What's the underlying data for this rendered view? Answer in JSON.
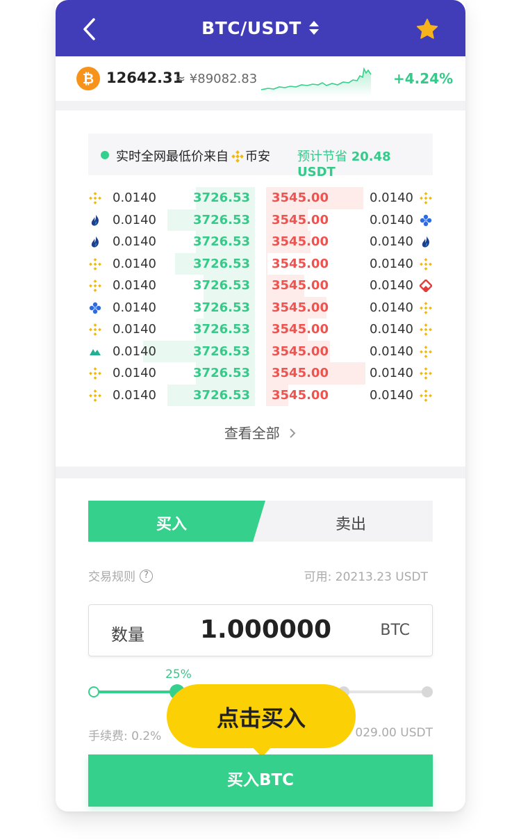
{
  "header": {
    "pair": "BTC/USDT"
  },
  "ticker": {
    "coin_symbol": "₿",
    "price": "12642.31",
    "cny": "≈ ¥89082.83",
    "change": "+4.24%"
  },
  "banner": {
    "text": "实时全网最低价来自",
    "exchange": "币安",
    "save_label": "预计节省",
    "save_value": "20.48 USDT"
  },
  "orderbook": {
    "rows": [
      {
        "left_icon": "binance-icon",
        "bid_amount": "0.0140",
        "bid_price": "3726.53",
        "bid_depth": 0.37,
        "ask_price": "3545.00",
        "ask_depth": 0.61,
        "ask_amount": "0.0140",
        "right_icon": "binance-icon"
      },
      {
        "left_icon": "huobi-icon",
        "bid_amount": "0.0140",
        "bid_price": "3726.53",
        "bid_depth": 0.55,
        "ask_price": "3545.00",
        "ask_depth": 0.26,
        "ask_amount": "0.0140",
        "right_icon": "okex-icon"
      },
      {
        "left_icon": "huobi-icon",
        "bid_amount": "0.0140",
        "bid_price": "3726.53",
        "bid_depth": 0.37,
        "ask_price": "3545.00",
        "ask_depth": 0.28,
        "ask_amount": "0.0140",
        "right_icon": "huobi-icon"
      },
      {
        "left_icon": "binance-icon",
        "bid_amount": "0.0140",
        "bid_price": "3726.53",
        "bid_depth": 0.5,
        "ask_price": "3545.00",
        "ask_depth": 0.01,
        "ask_amount": "0.0140",
        "right_icon": "binance-icon"
      },
      {
        "left_icon": "binance-icon",
        "bid_amount": "0.0140",
        "bid_price": "3726.53",
        "bid_depth": 0.32,
        "ask_price": "3545.00",
        "ask_depth": 0.24,
        "ask_amount": "0.0140",
        "right_icon": "gate-icon"
      },
      {
        "left_icon": "okex-icon",
        "bid_amount": "0.0140",
        "bid_price": "3726.53",
        "bid_depth": 0.32,
        "ask_price": "3545.00",
        "ask_depth": 0.38,
        "ask_amount": "0.0140",
        "right_icon": "binance-icon"
      },
      {
        "left_icon": "binance-icon",
        "bid_amount": "0.0140",
        "bid_price": "3726.53",
        "bid_depth": 0.37,
        "ask_price": "3545.00",
        "ask_depth": 0.26,
        "ask_amount": "0.0140",
        "right_icon": "binance-icon"
      },
      {
        "left_icon": "kucoin-icon",
        "bid_amount": "0.0140",
        "bid_price": "3726.53",
        "bid_depth": 0.7,
        "ask_price": "3545.00",
        "ask_depth": 0.4,
        "ask_amount": "0.0140",
        "right_icon": "binance-icon"
      },
      {
        "left_icon": "binance-icon",
        "bid_amount": "0.0140",
        "bid_price": "3726.53",
        "bid_depth": 0.37,
        "ask_price": "3545.00",
        "ask_depth": 0.62,
        "ask_amount": "0.0140",
        "right_icon": "binance-icon"
      },
      {
        "left_icon": "binance-icon",
        "bid_amount": "0.0140",
        "bid_price": "3726.53",
        "bid_depth": 0.55,
        "ask_price": "3545.00",
        "ask_depth": 0.14,
        "ask_amount": "0.0140",
        "right_icon": "binance-icon"
      }
    ],
    "view_all": "查看全部"
  },
  "trade": {
    "tab_buy": "买入",
    "tab_sell": "卖出",
    "rules": "交易规则",
    "available": "可用: 20213.23 USDT",
    "qty_label": "数量",
    "qty_value": "1.000000",
    "qty_unit": "BTC",
    "slider_value": 0.25,
    "slider_label": "25%",
    "fee": "手续费: 0.2%",
    "estimate": "029.00 USDT",
    "tooltip": "点击买入",
    "buy_button": "买入BTC"
  },
  "colors": {
    "header": "#413cb8",
    "green": "#35d08c",
    "red": "#ef5350",
    "tooltip": "#fbd004",
    "bitcoin": "#f7931a",
    "star": "#f6b31b"
  }
}
